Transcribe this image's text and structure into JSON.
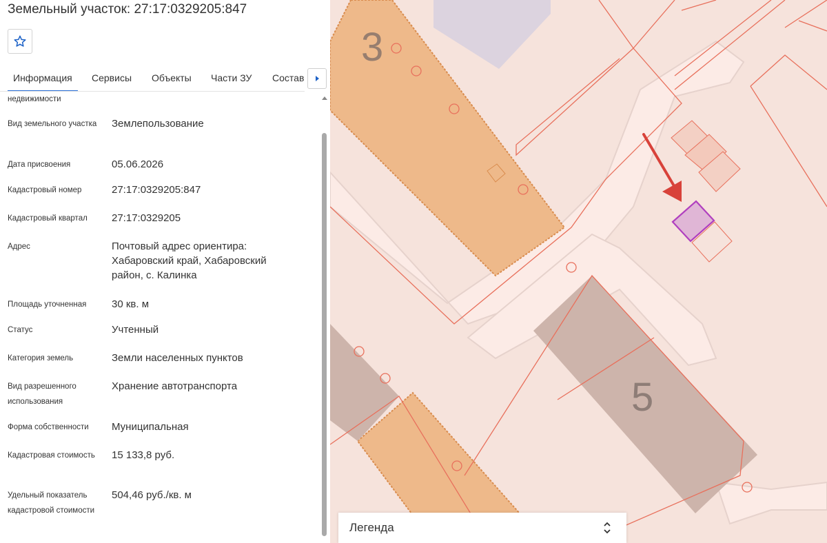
{
  "panel": {
    "title": "Земельный участок: 27:17:0329205:847",
    "favorite_icon": "star-icon",
    "tabs": [
      {
        "label": "Информация",
        "active": true
      },
      {
        "label": "Сервисы"
      },
      {
        "label": "Объекты"
      },
      {
        "label": "Части ЗУ"
      },
      {
        "label": "Состав"
      }
    ],
    "tabs_scroll_icon": "chevron-right-icon",
    "fields": [
      {
        "label": "недвижимости",
        "value": ""
      },
      {
        "label": "Вид земельного участка",
        "value": "Землепользование"
      },
      {
        "label": "Дата присвоения",
        "value": "05.06.2026"
      },
      {
        "label": "Кадастровый номер",
        "value": "27:17:0329205:847"
      },
      {
        "label": "Кадастровый квартал",
        "value": "27:17:0329205"
      },
      {
        "label": "Адрес",
        "value": "Почтовый адрес ориентира: Хабаровский край, Хабаровский район, с. Калинка"
      },
      {
        "label": "Площадь уточненная",
        "value": "30 кв. м"
      },
      {
        "label": "Статус",
        "value": "Учтенный"
      },
      {
        "label": "Категория земель",
        "value": "Земли населенных пунктов"
      },
      {
        "label": "Вид разрешенного использования",
        "value": "Хранение автотранспорта"
      },
      {
        "label": "Форма собственности",
        "value": "Муниципальная"
      },
      {
        "label": "Кадастровая стоимость",
        "value": "15 133,8 руб."
      },
      {
        "label": "Удельный показатель кадастровой стоимости",
        "value": "504,46 руб./кв. м"
      }
    ]
  },
  "map": {
    "building_labels": [
      "3",
      "5"
    ],
    "colors": {
      "background": "#f6e3dc",
      "parcel_border": "#e8705c",
      "building_orange": "#eeb98a",
      "building_gray": "#cdb4ab",
      "selected_parcel": "#b03fbf",
      "arrow": "#d8423a"
    }
  },
  "legend": {
    "label": "Легенда",
    "toggle_icon": "chevron-updown-icon"
  }
}
